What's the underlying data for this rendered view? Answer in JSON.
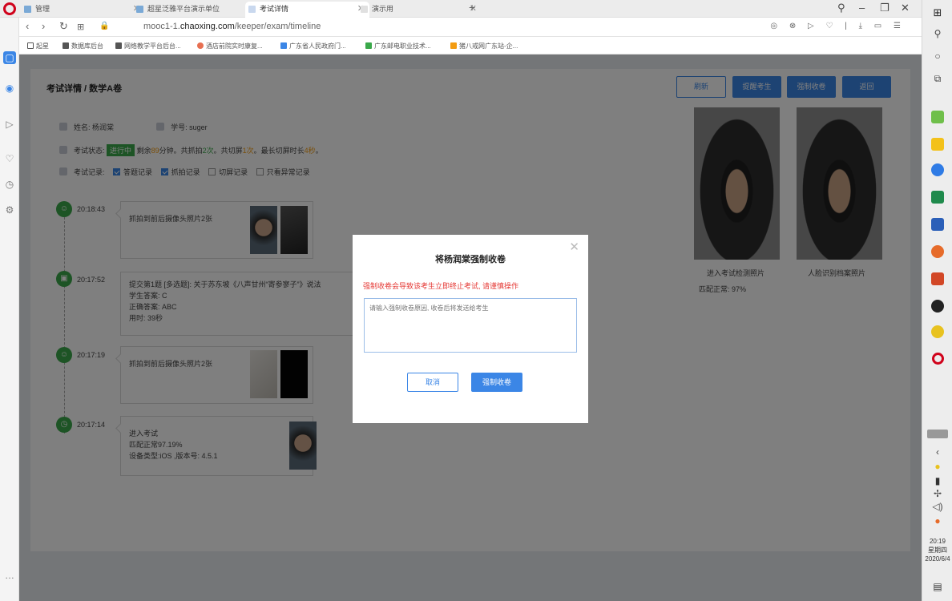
{
  "browser": {
    "tabs": [
      {
        "label": "管理"
      },
      {
        "label": "超星泛雅平台演示单位"
      },
      {
        "label": "考试详情"
      },
      {
        "label": "演示用"
      }
    ],
    "url_prefix": "mooc1-1.",
    "url_domain": "chaoxing.com",
    "url_path": "/keeper/exam/timeline",
    "bookmarks": [
      {
        "label": "起星",
        "color": "#555555"
      },
      {
        "label": "数据库后台",
        "color": "#555555"
      },
      {
        "label": "网络教学平台后台...",
        "color": "#555555"
      },
      {
        "label": "酒店前院实时康复...",
        "color": "#e76f51"
      },
      {
        "label": "广东省人民政府门...",
        "color": "#3b86e6"
      },
      {
        "label": "广东邮电职业技术...",
        "color": "#3aa84a"
      },
      {
        "label": "猪八戒网广东站-企...",
        "color": "#f39c12"
      }
    ]
  },
  "page": {
    "title": "考试详情 / 数学A卷",
    "buttons": {
      "refresh": "刷新",
      "remind": "提醒考生",
      "force_submit": "强制收卷",
      "back": "返回"
    },
    "student": {
      "name_label": "姓名:",
      "name": "杨润棠",
      "id_label": "学号:",
      "id": "suger"
    },
    "status": {
      "label": "考试状态:",
      "badge": "进行中",
      "remaining_prefix": "剩余",
      "remaining_minutes": "89",
      "remaining_suffix": "分钟。共抓拍",
      "captures": "2次",
      "switch_prefix": "。共切屏",
      "switches": "1次",
      "longest_prefix": "。最长切屏时长",
      "longest": "4秒",
      "end": "。"
    },
    "records": {
      "label": "考试记录:",
      "filters": [
        {
          "label": "答题记录",
          "checked": true
        },
        {
          "label": "抓拍记录",
          "checked": true
        },
        {
          "label": "切屏记录",
          "checked": false
        },
        {
          "label": "只看异常记录",
          "checked": false
        }
      ]
    },
    "timeline": [
      {
        "time": "20:18:43",
        "lines": [
          "抓拍到前后摄像头照片2张"
        ]
      },
      {
        "time": "20:17:52",
        "lines": [
          "提交第1题 [多选题]: 关于苏东坡《八声甘州“寄参寥子”》说法",
          "学生答案: C",
          "正确答案: ABC",
          "用时: 39秒"
        ]
      },
      {
        "time": "20:17:19",
        "lines": [
          "抓拍到前后摄像头照片2张"
        ]
      },
      {
        "time": "20:17:14",
        "lines": [
          "进入考试",
          "匹配正常97.19%",
          "设备类型:iOS ,版本号: 4.5.1"
        ]
      }
    ],
    "photos": {
      "left_caption": "进入考试检测照片",
      "match_label": "匹配正常:",
      "match_value": "97%",
      "right_caption": "人脸识别档案照片"
    }
  },
  "modal": {
    "title": "将杨润棠强制收卷",
    "warning": "强制收卷会导致该考生立即终止考试, 请谨慎操作",
    "placeholder": "请输入强制收卷原因, 收卷后将发送给考生",
    "cancel": "取消",
    "confirm": "强制收卷"
  },
  "taskbar": {
    "time": "20:19",
    "weekday": "星期四",
    "date": "2020/6/4"
  }
}
